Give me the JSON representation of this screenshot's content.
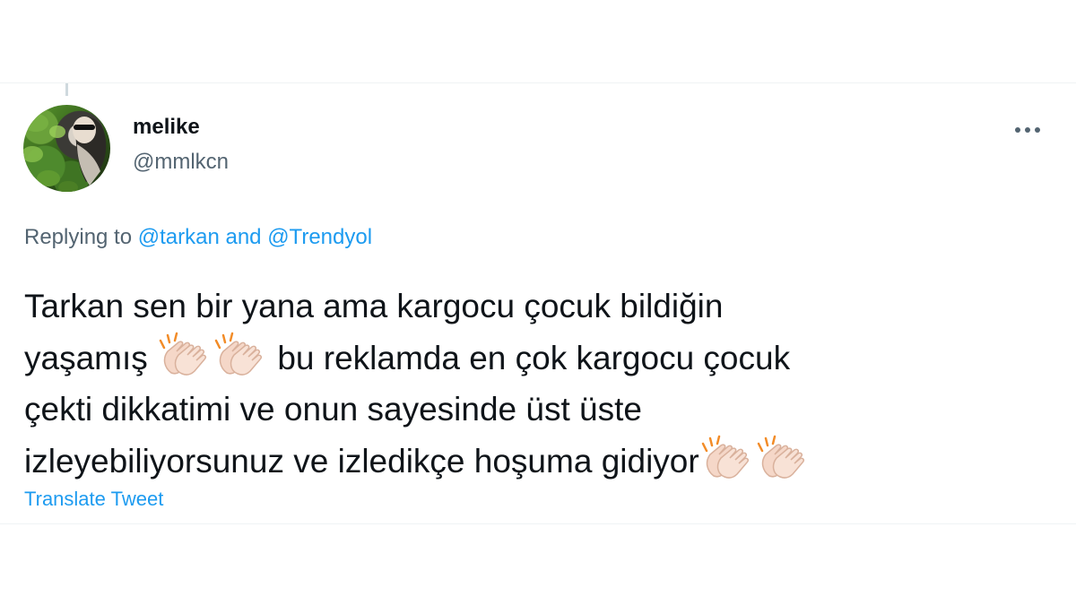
{
  "tweet": {
    "author": {
      "display_name": "melike",
      "handle": "@mmlkcn"
    },
    "more_icon": "more-horizontal-icon",
    "reply_context": {
      "prefix": "Replying to ",
      "mentions_text": "@tarkan and @Trendyol"
    },
    "text_lines": {
      "line1": "Tarkan sen bir yana ama kargocu çocuk bildiğin",
      "line2_start": "yaşamış",
      "line2_end": "bu reklamda en çok kargocu çocuk",
      "line3": "çekti dikkatimi ve onun sayesinde üst üste",
      "line4": "izleyebiliyorsunuz ve izledikçe hoşuma gidiyor"
    },
    "emoji_icon": "clapping-hands-icon",
    "translate_label": "Translate Tweet",
    "colors": {
      "link": "#1d9bf0",
      "secondary_text": "#536471",
      "primary_text": "#0f1419"
    }
  }
}
